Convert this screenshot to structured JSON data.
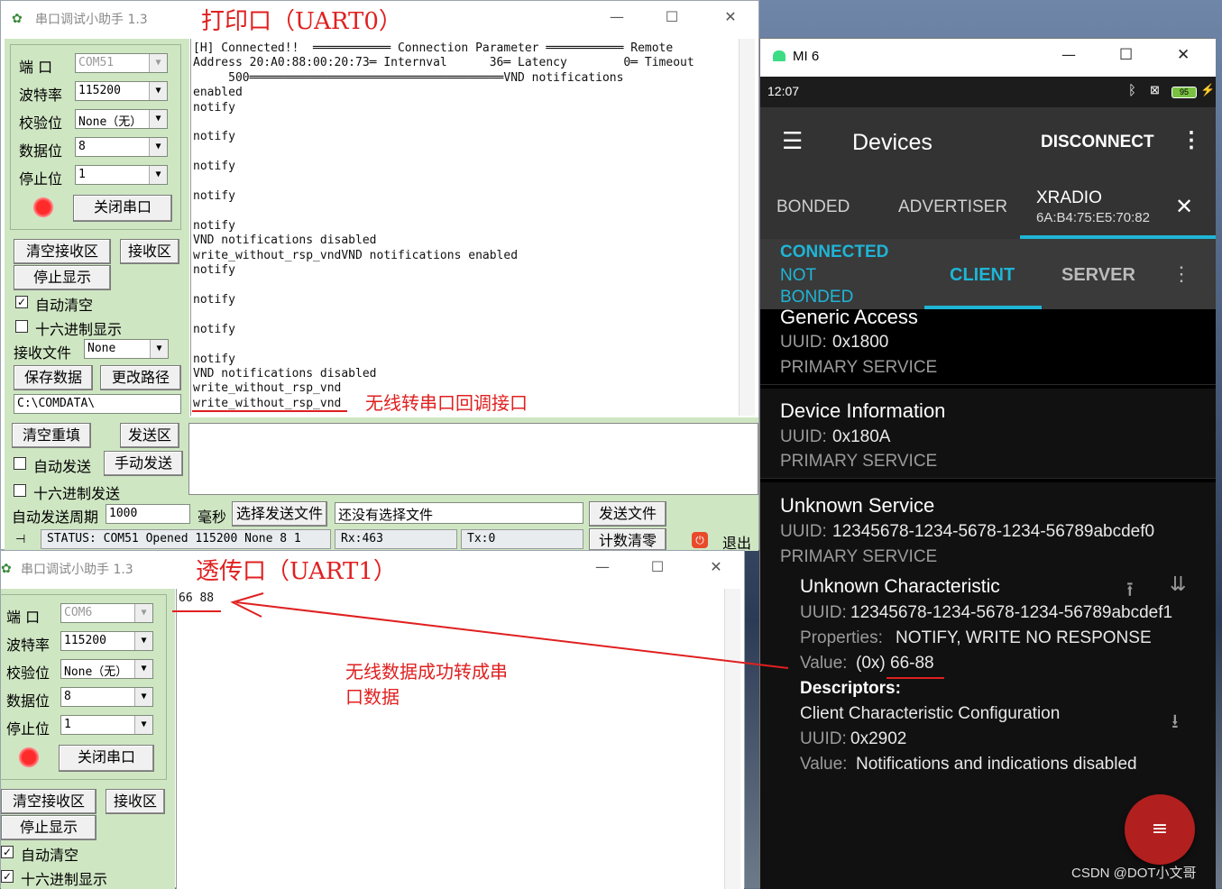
{
  "uart0": {
    "window_title": "串口调试小助手 1.3",
    "annotation": "打印口（UART0）",
    "labels": {
      "port": "端  口",
      "baud": "波特率",
      "parity": "校验位",
      "databits": "数据位",
      "stopbits": "停止位"
    },
    "values": {
      "port": "COM51",
      "baud": "115200",
      "parity": "None（无）",
      "databits": "8",
      "stopbits": "1"
    },
    "close_port": "关闭串口",
    "clear_recv": "清空接收区",
    "recv_area": "接收区",
    "stop_display": "停止显示",
    "auto_clear": "自动清空",
    "hex_display": "十六进制显示",
    "recv_file": "接收文件",
    "recv_file_value": "None",
    "save_data": "保存数据",
    "change_path": "更改路径",
    "path": "C:\\COMDATA\\",
    "log_lines": [
      "[H] Connected!!  ═══════════ Connection Parameter ═══════════ Remote",
      "Address 20:A0:88:00:20:73═ Internval      36═ Latency        0═ Timeout",
      "     500════════════════════════════════════VND notifications",
      "enabled",
      "notify",
      "",
      "notify",
      "",
      "notify",
      "",
      "notify",
      "",
      "notify",
      "VND notifications disabled",
      "write_without_rsp_vndVND notifications enabled",
      "notify",
      "",
      "notify",
      "",
      "notify",
      "",
      "notify",
      "VND notifications disabled",
      "write_without_rsp_vnd",
      "write_without_rsp_vnd"
    ],
    "loop_annotation": "无线转串口回调接口",
    "clear_refill": "清空重填",
    "send_area": "发送区",
    "auto_send": "自动发送",
    "manual_send": "手动发送",
    "hex_send": "十六进制发送",
    "auto_period_label": "自动发送周期",
    "auto_period": "1000",
    "ms": "毫秒",
    "choose_file": "选择发送文件",
    "no_file": "还没有选择文件",
    "send_file": "发送文件",
    "status": "STATUS: COM51 Opened 115200 None  8 1",
    "rx": "Rx:463",
    "tx": "Tx:0",
    "reset_count": "计数清零",
    "exit": "退出"
  },
  "uart1": {
    "window_title": "串口调试小助手 1.3",
    "annotation": "透传口（UART1）",
    "labels": {
      "port": "端  口",
      "baud": "波特率",
      "parity": "校验位",
      "databits": "数据位",
      "stopbits": "停止位"
    },
    "values": {
      "port": "COM6",
      "baud": "115200",
      "parity": "None（无）",
      "databits": "8",
      "stopbits": "1"
    },
    "close_port": "关闭串口",
    "clear_recv": "清空接收区",
    "recv_area": "接收区",
    "stop_display": "停止显示",
    "auto_clear": "自动清空",
    "hex_display": "十六进制显示",
    "received": "66 88",
    "arrow_annotation_1": "无线数据成功转成串",
    "arrow_annotation_2": "口数据"
  },
  "phone": {
    "window_title": "MI 6",
    "time": "12:07",
    "battery": "95",
    "app_title": "Devices",
    "disconnect": "DISCONNECT",
    "tabs": [
      "BONDED",
      "ADVERTISER"
    ],
    "device_name": "XRADIO",
    "device_mac": "6A:B4:75:E5:70:82",
    "conn_state": "CONNECTED",
    "bond_state_1": "NOT",
    "bond_state_2": "BONDED",
    "sub_tabs": [
      "CLIENT",
      "SERVER"
    ],
    "services": [
      {
        "name": "Generic Access",
        "uuid_label": "UUID:",
        "uuid": "0x1800",
        "type": "PRIMARY SERVICE"
      },
      {
        "name": "Device Information",
        "uuid_label": "UUID:",
        "uuid": "0x180A",
        "type": "PRIMARY SERVICE"
      },
      {
        "name": "Unknown Service",
        "uuid_label": "UUID:",
        "uuid": "12345678-1234-5678-1234-56789abcdef0",
        "type": "PRIMARY SERVICE"
      }
    ],
    "characteristic": {
      "name": "Unknown Characteristic",
      "uuid_label": "UUID:",
      "uuid": "12345678-1234-5678-1234-56789abcdef1",
      "props_label": "Properties:",
      "props": "NOTIFY, WRITE NO RESPONSE",
      "value_label": "Value:",
      "value": "(0x) 66-88",
      "descriptors": "Descriptors:",
      "desc_name": "Client Characteristic Configuration",
      "desc_uuid": "0x2902",
      "desc_value": "Notifications and indications disabled"
    },
    "watermark": "CSDN @DOT小文哥"
  }
}
